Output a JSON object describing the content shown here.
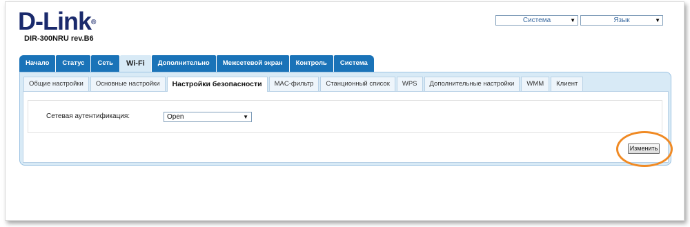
{
  "brand": {
    "logo": "D-Link",
    "reg_mark": "®",
    "model": "DIR-300NRU rev.B6"
  },
  "header_selects": [
    {
      "label": "Система",
      "icon": "dropdown-arrow-icon"
    },
    {
      "label": "Язык",
      "icon": "dropdown-arrow-icon"
    }
  ],
  "main_tabs": [
    {
      "label": "Начало",
      "active": false
    },
    {
      "label": "Статус",
      "active": false
    },
    {
      "label": "Сеть",
      "active": false
    },
    {
      "label": "Wi-Fi",
      "active": true
    },
    {
      "label": "Дополнительно",
      "active": false
    },
    {
      "label": "Межсетевой экран",
      "active": false
    },
    {
      "label": "Контроль",
      "active": false
    },
    {
      "label": "Система",
      "active": false
    }
  ],
  "sub_tabs": [
    {
      "label": "Общие настройки",
      "active": false
    },
    {
      "label": "Основные настройки",
      "active": false
    },
    {
      "label": "Настройки безопасности",
      "active": true
    },
    {
      "label": "MAC-фильтр",
      "active": false
    },
    {
      "label": "Станционный список",
      "active": false
    },
    {
      "label": "WPS",
      "active": false
    },
    {
      "label": "Дополнительные настройки",
      "active": false
    },
    {
      "label": "WMM",
      "active": false
    },
    {
      "label": "Клиент",
      "active": false
    }
  ],
  "form": {
    "auth_label": "Сетевая аутентификация:",
    "auth_value": "Open"
  },
  "apply_button": "Изменить",
  "colors": {
    "tab_blue": "#1a73b8",
    "panel_light": "#d8eaf6",
    "highlight_orange": "#f08a24",
    "logo_navy": "#1a2a6c"
  }
}
